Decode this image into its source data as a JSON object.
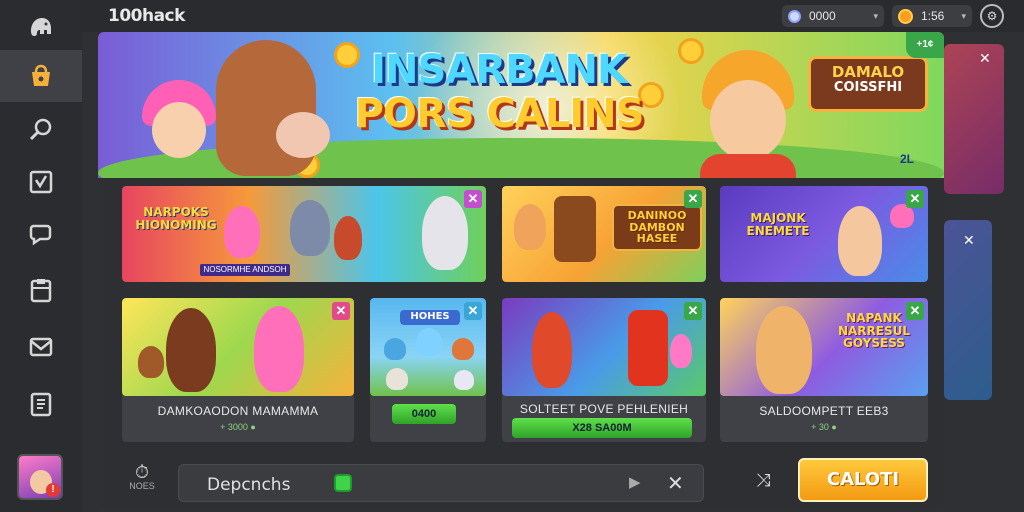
{
  "topbar": {
    "brand": "100hack",
    "gems_value": "0000",
    "coins_value": "1:56",
    "caret": "▾"
  },
  "sidebar": {
    "items": [
      {
        "name": "home",
        "icon": "elephant-icon"
      },
      {
        "name": "store",
        "icon": "bag-icon"
      },
      {
        "name": "search",
        "icon": "magnifier-icon"
      },
      {
        "name": "tasks",
        "icon": "checklist-icon"
      },
      {
        "name": "chat",
        "icon": "chat-icon"
      },
      {
        "name": "clipboard",
        "icon": "clipboard-icon"
      },
      {
        "name": "mail",
        "icon": "mail-icon"
      },
      {
        "name": "book",
        "icon": "book-icon"
      }
    ],
    "avatar_badge": "!"
  },
  "hero": {
    "title_line1": "INSARBANK",
    "title_line2": "PORS CALINS",
    "sign_line1": "DAMALO",
    "sign_line2": "COISSFHI",
    "badge": "+1¢",
    "small": "2L"
  },
  "cards": [
    {
      "art_text": "NARPOKS\nHIONOMING",
      "banner": "NOSORMHE ANDSOH",
      "close": "✕"
    },
    {
      "art_text": "DANINOO\nDAMBON\nHASEE",
      "close": "✕"
    },
    {
      "art_text": "MAJONK\nENEMETE",
      "close": "✕"
    },
    {
      "caption": "DAMKOAODON MAMAMMA",
      "sub": "+ 3000 ●",
      "close": "✕"
    },
    {
      "art_text": "HOHES",
      "pill": "0400",
      "close": "✕"
    },
    {
      "caption": "SOLTEET POVE PEHLENIEH",
      "pill": "X28 SA00M",
      "close": "✕"
    },
    {
      "art_text": "NAPANK\nNARRESUL\nGOYSESS",
      "caption": "SALDOOMPETT EEB3",
      "sub": "+ 30 ●",
      "close": "✕"
    }
  ],
  "bottom": {
    "left_label": "NOES",
    "search_text": "Depcnchs",
    "collect_label": "CALOTI"
  },
  "colors": {
    "accent": "#f5b03a",
    "collect": "#f39a12",
    "green": "#3fd34a",
    "panel": "#2e2f33"
  }
}
